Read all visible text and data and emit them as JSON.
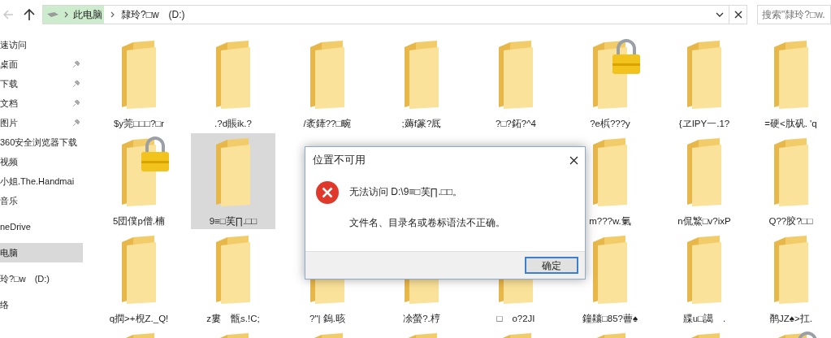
{
  "address_bar": {
    "back_disabled": true,
    "segments": [
      "此电脑",
      "隸玲?□w　(D:)"
    ],
    "search_placeholder": "搜索\"隸玲?□w."
  },
  "nav_groups": [
    [
      {
        "label": "速访问",
        "pinned": false,
        "selected": false
      },
      {
        "label": "桌面",
        "pinned": true,
        "selected": false
      },
      {
        "label": "下载",
        "pinned": true,
        "selected": false
      },
      {
        "label": "文档",
        "pinned": true,
        "selected": false
      },
      {
        "label": "图片",
        "pinned": true,
        "selected": false
      },
      {
        "label": "360安全浏览器下载",
        "pinned": false,
        "selected": false
      },
      {
        "label": "视频",
        "pinned": false,
        "selected": false
      },
      {
        "label": "小姐.The.Handmai",
        "pinned": false,
        "selected": false
      },
      {
        "label": "音乐",
        "pinned": false,
        "selected": false
      }
    ],
    [
      {
        "label": "neDrive",
        "pinned": false,
        "selected": false
      }
    ],
    [
      {
        "label": "电脑",
        "pinned": false,
        "selected": true
      }
    ],
    [
      {
        "label": "玲?□w　(D:)",
        "pinned": false,
        "selected": false
      }
    ],
    [
      {
        "label": "络",
        "pinned": false,
        "selected": false
      }
    ]
  ],
  "rows": [
    [
      {
        "name": "$y莞□□□?□r",
        "selected": false,
        "locked": false
      },
      {
        "name": ".?d賬ik.?",
        "selected": false,
        "locked": false
      },
      {
        "name": "/袤鏲??□畹",
        "selected": false,
        "locked": false
      },
      {
        "name": ";薅f篆?厎",
        "selected": false,
        "locked": false
      },
      {
        "name": "?□?鉐?^4",
        "selected": false,
        "locked": false
      },
      {
        "name": "?e梹???y",
        "selected": false,
        "locked": true
      },
      {
        "name": "{ヱIPY一.1?",
        "selected": false,
        "locked": false
      },
      {
        "name": "=硬<肽矾. 'q",
        "selected": false,
        "locked": false
      }
    ],
    [
      {
        "name": "5団僕p僧.楠",
        "selected": false,
        "locked": true
      },
      {
        "name": "9≡□芙∏.□□",
        "selected": true,
        "locked": false
      },
      null,
      null,
      null,
      {
        "name": "m???w.氭",
        "selected": false,
        "locked": false
      },
      {
        "name": "n侃鰵□v?ixP",
        "selected": false,
        "locked": false
      },
      {
        "name": "Q??胶?□□",
        "selected": false,
        "locked": false
      }
    ],
    [
      {
        "name": "q撋>+棿Z._Q!",
        "selected": false,
        "locked": false
      },
      {
        "name": "z婁　甑s.!C;",
        "selected": false,
        "locked": false
      },
      {
        "name": "?\"| 鎢.晐",
        "selected": false
      },
      {
        "name": "凃螢?.梈",
        "selected": false
      },
      {
        "name": "□　o?2JI",
        "selected": false
      },
      {
        "name": "鐘齉□85?蓸♠",
        "selected": false,
        "locked": false
      },
      {
        "name": "牃u□譪　.",
        "selected": false,
        "locked": false
      },
      {
        "name": "鹡JZ♠>扛.",
        "selected": false,
        "locked": false
      }
    ],
    [
      {
        "selected": false,
        "locked": false
      },
      {
        "selected": false,
        "locked": false
      },
      {
        "selected": false,
        "locked": false
      },
      {
        "selected": false,
        "locked": false
      },
      {
        "selected": false,
        "locked": false
      },
      {
        "selected": false,
        "locked": false
      },
      {
        "selected": false,
        "locked": false
      },
      {
        "selected": false,
        "locked": true
      }
    ]
  ],
  "dialog": {
    "title": "位置不可用",
    "message": "无法访问 D:\\9≡□芙∏.□□。",
    "detail": "文件名、目录名或卷标语法不正确。",
    "button": "确定"
  }
}
